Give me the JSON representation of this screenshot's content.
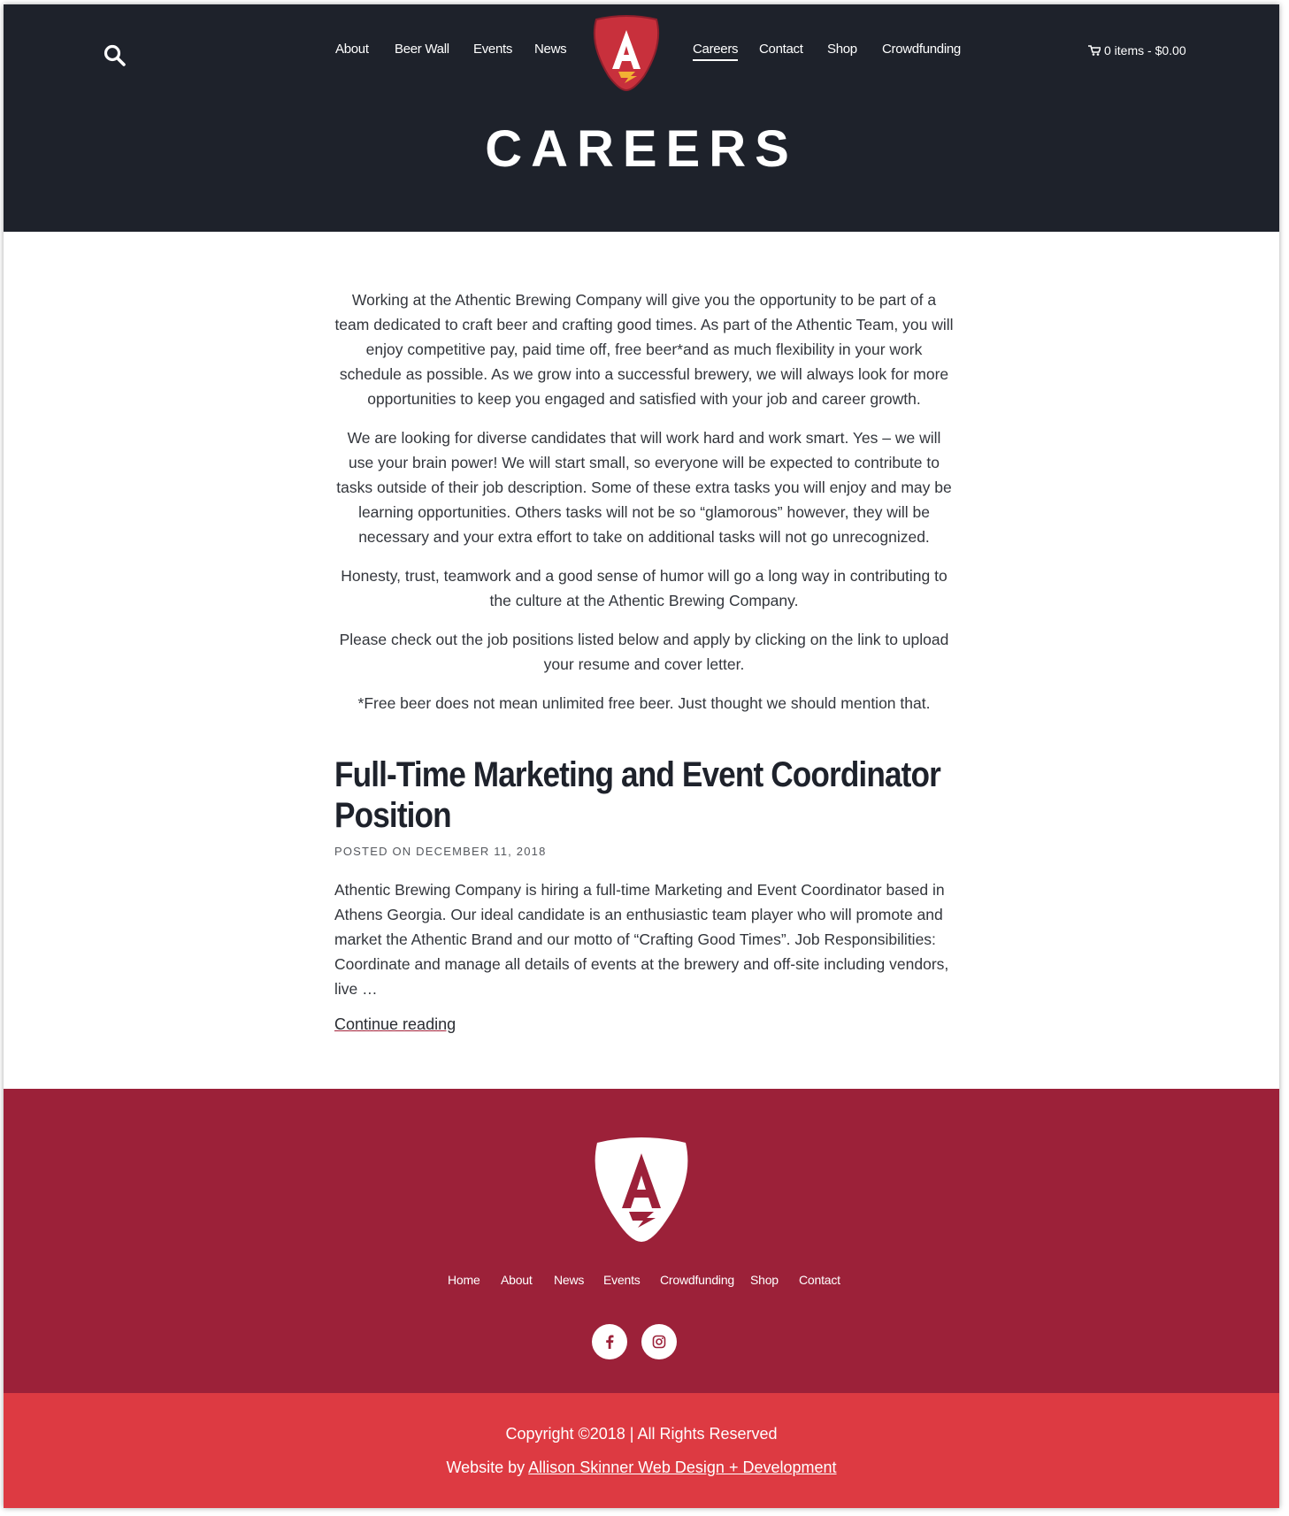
{
  "header": {
    "nav_left": [
      "About",
      "Beer Wall",
      "Events",
      "News"
    ],
    "nav_right": [
      "Careers",
      "Contact",
      "Shop",
      "Crowdfunding"
    ],
    "active_item": "Careers",
    "cart_label": "0 items - $0.00",
    "title": "CAREERS"
  },
  "intro": {
    "p1": "Working at the Athentic Brewing Company will give you the opportunity to be part of a team dedicated to craft beer and crafting good times. As part of the Athentic Team, you will enjoy competitive pay, paid time off, free beer*and as much flexibility in your work schedule as possible. As we grow into a successful brewery, we will always look for more opportunities to keep you engaged and satisfied with your job and career growth.",
    "p2": "We are looking for diverse candidates that will work hard and work smart. Yes – we will use your brain power! We will start small, so everyone will be expected to contribute to tasks outside of their job description. Some of these extra tasks you will enjoy and may be learning opportunities. Others tasks will not be so “glamorous” however, they will be necessary and your extra effort to take on additional tasks will not go unrecognized.",
    "p3": "Honesty, trust, teamwork and a good sense of humor will go a long way in contributing to the culture at the Athentic Brewing Company.",
    "p4": "Please check out the job positions listed below and apply by clicking on the link to upload your resume and cover letter.",
    "p5": "*Free beer does not mean unlimited free beer. Just thought we should mention that."
  },
  "post": {
    "title": "Full-Time Marketing and Event Coordinator Position",
    "meta": "POSTED ON DECEMBER 11, 2018",
    "excerpt": "Athentic Brewing Company is hiring a full-time Marketing and Event Coordinator based in Athens Georgia. Our ideal candidate is an enthusiastic team player who will promote and market the Athentic Brand and our motto of “Crafting Good Times”. Job Responsibilities: Coordinate and manage all details of events at the brewery and off-site including vendors, live …",
    "more_label": "Continue reading"
  },
  "footer": {
    "nav": [
      "Home",
      "About",
      "News",
      "Events",
      "Crowdfunding",
      "Shop",
      "Contact"
    ],
    "copyright": "Copyright ©2018 | All Rights Reserved",
    "credit_prefix": "Website by ",
    "credit_link": "Allison Skinner Web Design + Development"
  },
  "colors": {
    "header_bg": "#1e222b",
    "footer_bg": "#9c2139",
    "bottom_bg": "#dd3a42",
    "logo_red": "#c8303c"
  },
  "icons": [
    "search-icon",
    "cart-icon",
    "facebook-icon",
    "instagram-icon",
    "logo-icon"
  ]
}
